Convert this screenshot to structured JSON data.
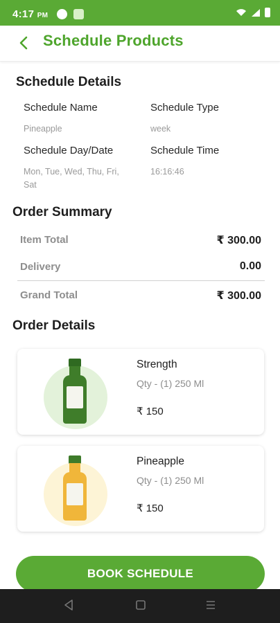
{
  "status_bar": {
    "time": "4:17",
    "ampm": "PM",
    "signal_text": "⧉ ✶ ▲ ııl"
  },
  "header": {
    "title": "Schedule Products",
    "back_icon": "chevron-left-icon"
  },
  "schedule_details": {
    "heading": "Schedule Details",
    "name_label": "Schedule Name",
    "name_value": "Pineapple",
    "type_label": "Schedule Type",
    "type_value": "week",
    "day_label": "Schedule Day/Date",
    "day_value": "Mon, Tue, Wed, Thu, Fri, Sat",
    "time_label": "Schedule Time",
    "time_value": "16:16:46"
  },
  "order_summary": {
    "heading": "Order Summary",
    "item_total_label": "Item Total",
    "item_total_value": "₹ 300.00",
    "delivery_label": "Delivery",
    "delivery_value": "0.00",
    "grand_total_label": "Grand Total",
    "grand_total_value": "₹ 300.00"
  },
  "order_details": {
    "heading": "Order Details",
    "products": [
      {
        "name": "Strength",
        "qty": "Qty - (1) 250 Ml",
        "price": "₹ 150",
        "circle_color": "#e3f2da",
        "bottle_color": "#3f7d2a",
        "cap_color": "#2f6a21"
      },
      {
        "name": "Pineapple",
        "qty": "Qty - (1) 250 Ml",
        "price": "₹ 150",
        "circle_color": "#fdf4d6",
        "bottle_color": "#f0b63a",
        "cap_color": "#3e7b2a"
      }
    ]
  },
  "actions": {
    "book_label": "BOOK SCHEDULE"
  },
  "colors": {
    "brand_green": "#5aaa35",
    "title_green": "#4ea52c"
  }
}
